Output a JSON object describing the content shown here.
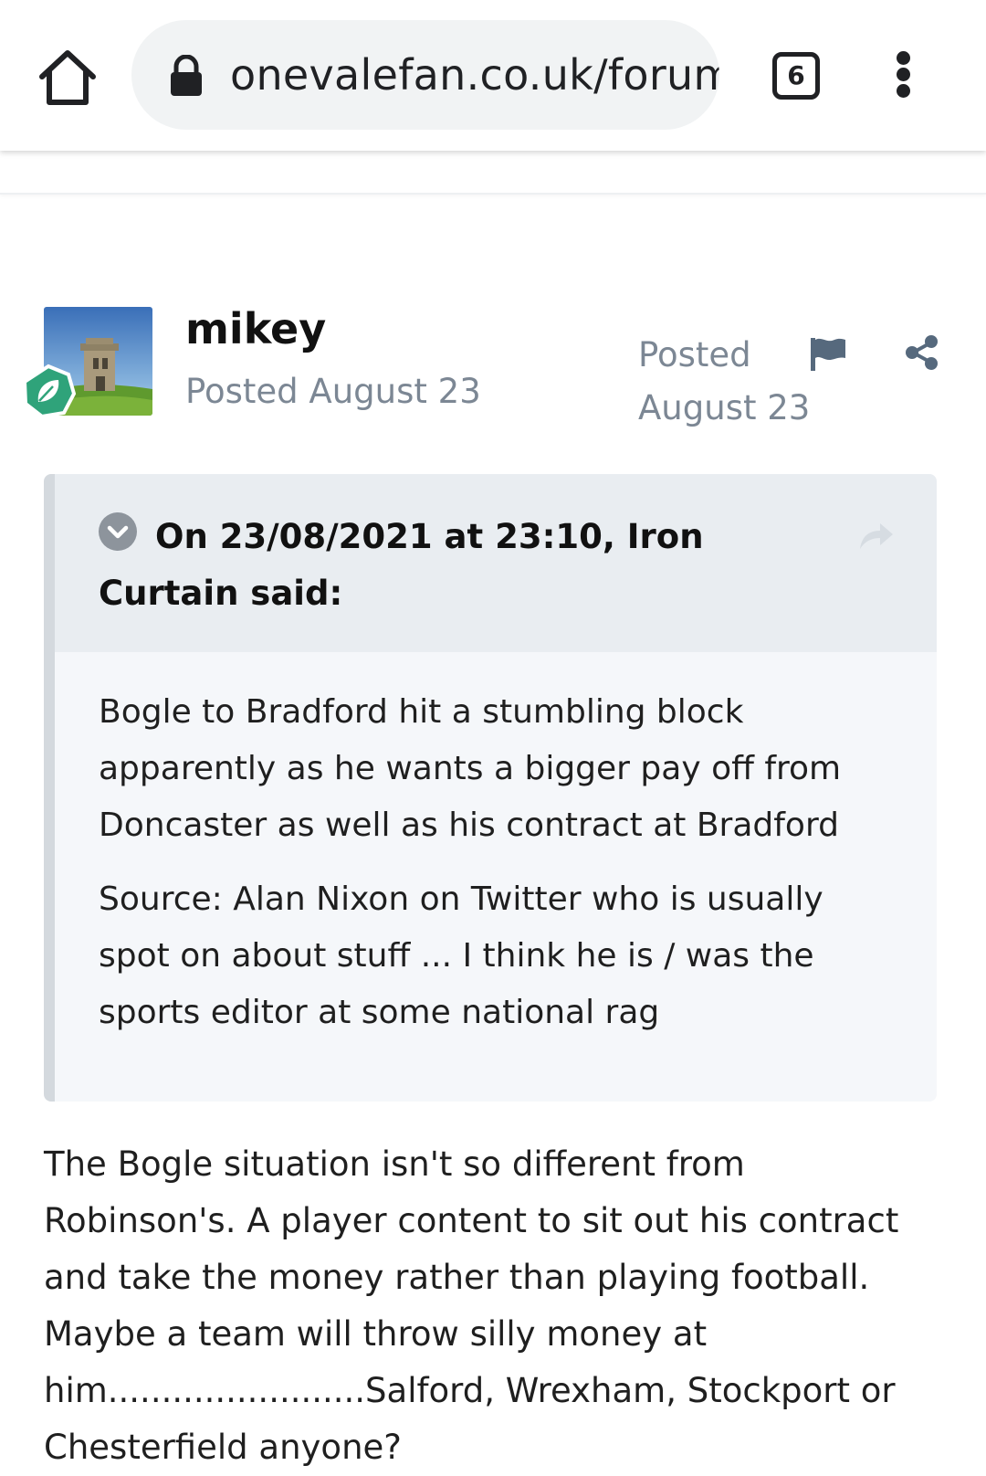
{
  "browser": {
    "url": "onevalefan.co.uk/forum/",
    "tab_count": "6",
    "icons": {
      "home": "home-icon",
      "lock": "lock-icon",
      "menu": "vertical-dots-icon"
    }
  },
  "post": {
    "author": "mikey",
    "posted": "Posted August 23",
    "posted_right": "Posted August 23",
    "icons": {
      "report": "flag-icon",
      "share": "share-icon",
      "badge": "leaf-badge-icon"
    },
    "quote": {
      "citation": "On 23/08/2021 at 23:10, Iron Curtain said:",
      "paragraphs": [
        "Bogle to Bradford hit a stumbling block apparently as he wants a bigger pay off from Doncaster as well as his contract at Bradford",
        "Source: Alan Nixon on Twitter who is usually spot on about stuff ... I think he is / was the sports editor at some national rag"
      ]
    },
    "body": "The Bogle situation isn't so different from Robinson's. A player content to sit out his contract and take the money rather than playing football.  Maybe a team will throw silly money at him........................Salford, Wrexham, Stockport or Chesterfield anyone?"
  },
  "colors": {
    "meta_grey": "#7c8794",
    "quote_border": "#d4d9de",
    "quote_head_bg": "#e9edf1",
    "quote_body_bg": "#f5f7fa",
    "badge_green": "#2fa37a"
  }
}
